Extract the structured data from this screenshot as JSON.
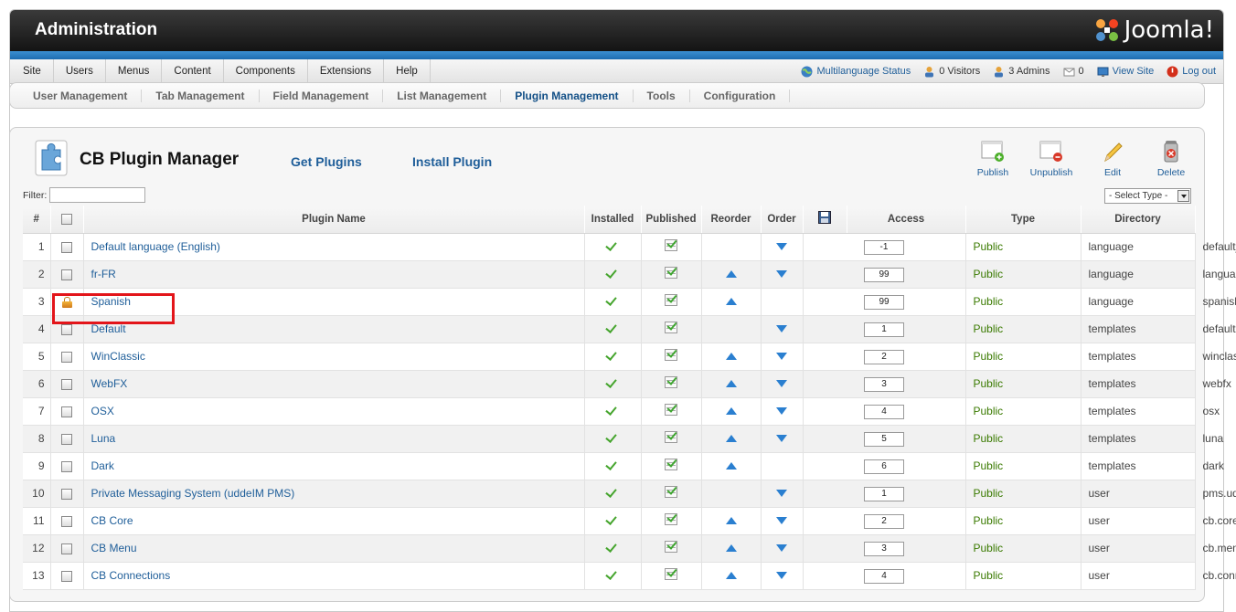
{
  "header": {
    "title": "Administration",
    "brand": "Joomla!"
  },
  "menu": [
    "Site",
    "Users",
    "Menus",
    "Content",
    "Components",
    "Extensions",
    "Help"
  ],
  "status": {
    "multilanguage": "Multilanguage Status",
    "visitors": "0 Visitors",
    "admins": "3 Admins",
    "messages": "0",
    "view_site": "View Site",
    "logout": "Log out"
  },
  "submenu": [
    "User Management",
    "Tab Management",
    "Field Management",
    "List Management",
    "Plugin Management",
    "Tools",
    "Configuration"
  ],
  "submenu_active": "Plugin Management",
  "page": {
    "title": "CB Plugin Manager",
    "get_plugins": "Get Plugins",
    "install_plugin": "Install Plugin"
  },
  "toolbar": {
    "publish": "Publish",
    "unpublish": "Unpublish",
    "edit": "Edit",
    "delete": "Delete"
  },
  "filter": {
    "label": "Filter:",
    "value": "",
    "type_select": "- Select Type -"
  },
  "table": {
    "headers": {
      "num": "#",
      "name": "Plugin Name",
      "installed": "Installed",
      "published": "Published",
      "reorder": "Reorder",
      "order": "Order",
      "access": "Access",
      "type": "Type",
      "directory": "Directory"
    },
    "rows": [
      {
        "num": "1",
        "name": "Default language (English)",
        "locked": false,
        "up": false,
        "down": true,
        "order": "-1",
        "access": "Public",
        "type": "language",
        "directory": "default_language"
      },
      {
        "num": "2",
        "name": "fr-FR",
        "locked": false,
        "up": true,
        "down": true,
        "order": "99",
        "access": "Public",
        "type": "language",
        "directory": "language"
      },
      {
        "num": "3",
        "name": "Spanish",
        "locked": true,
        "up": true,
        "down": false,
        "order": "99",
        "access": "Public",
        "type": "language",
        "directory": "spanish"
      },
      {
        "num": "4",
        "name": "Default",
        "locked": false,
        "up": false,
        "down": true,
        "order": "1",
        "access": "Public",
        "type": "templates",
        "directory": "default"
      },
      {
        "num": "5",
        "name": "WinClassic",
        "locked": false,
        "up": true,
        "down": true,
        "order": "2",
        "access": "Public",
        "type": "templates",
        "directory": "winclassic"
      },
      {
        "num": "6",
        "name": "WebFX",
        "locked": false,
        "up": true,
        "down": true,
        "order": "3",
        "access": "Public",
        "type": "templates",
        "directory": "webfx"
      },
      {
        "num": "7",
        "name": "OSX",
        "locked": false,
        "up": true,
        "down": true,
        "order": "4",
        "access": "Public",
        "type": "templates",
        "directory": "osx"
      },
      {
        "num": "8",
        "name": "Luna",
        "locked": false,
        "up": true,
        "down": true,
        "order": "5",
        "access": "Public",
        "type": "templates",
        "directory": "luna"
      },
      {
        "num": "9",
        "name": "Dark",
        "locked": false,
        "up": true,
        "down": false,
        "order": "6",
        "access": "Public",
        "type": "templates",
        "directory": "dark"
      },
      {
        "num": "10",
        "name": "Private Messaging System (uddeIM PMS)",
        "locked": false,
        "up": false,
        "down": true,
        "order": "1",
        "access": "Public",
        "type": "user",
        "directory": "pms.uddeim"
      },
      {
        "num": "11",
        "name": "CB Core",
        "locked": false,
        "up": true,
        "down": true,
        "order": "2",
        "access": "Public",
        "type": "user",
        "directory": "cb.core"
      },
      {
        "num": "12",
        "name": "CB Menu",
        "locked": false,
        "up": true,
        "down": true,
        "order": "3",
        "access": "Public",
        "type": "user",
        "directory": "cb.menu"
      },
      {
        "num": "13",
        "name": "CB Connections",
        "locked": false,
        "up": true,
        "down": true,
        "order": "4",
        "access": "Public",
        "type": "user",
        "directory": "cb.connections"
      }
    ]
  },
  "colors": {
    "link": "#1f5e99",
    "access": "#3a7a00",
    "highlight": "#e3151a",
    "blue_strip": "#2a7fd0"
  }
}
